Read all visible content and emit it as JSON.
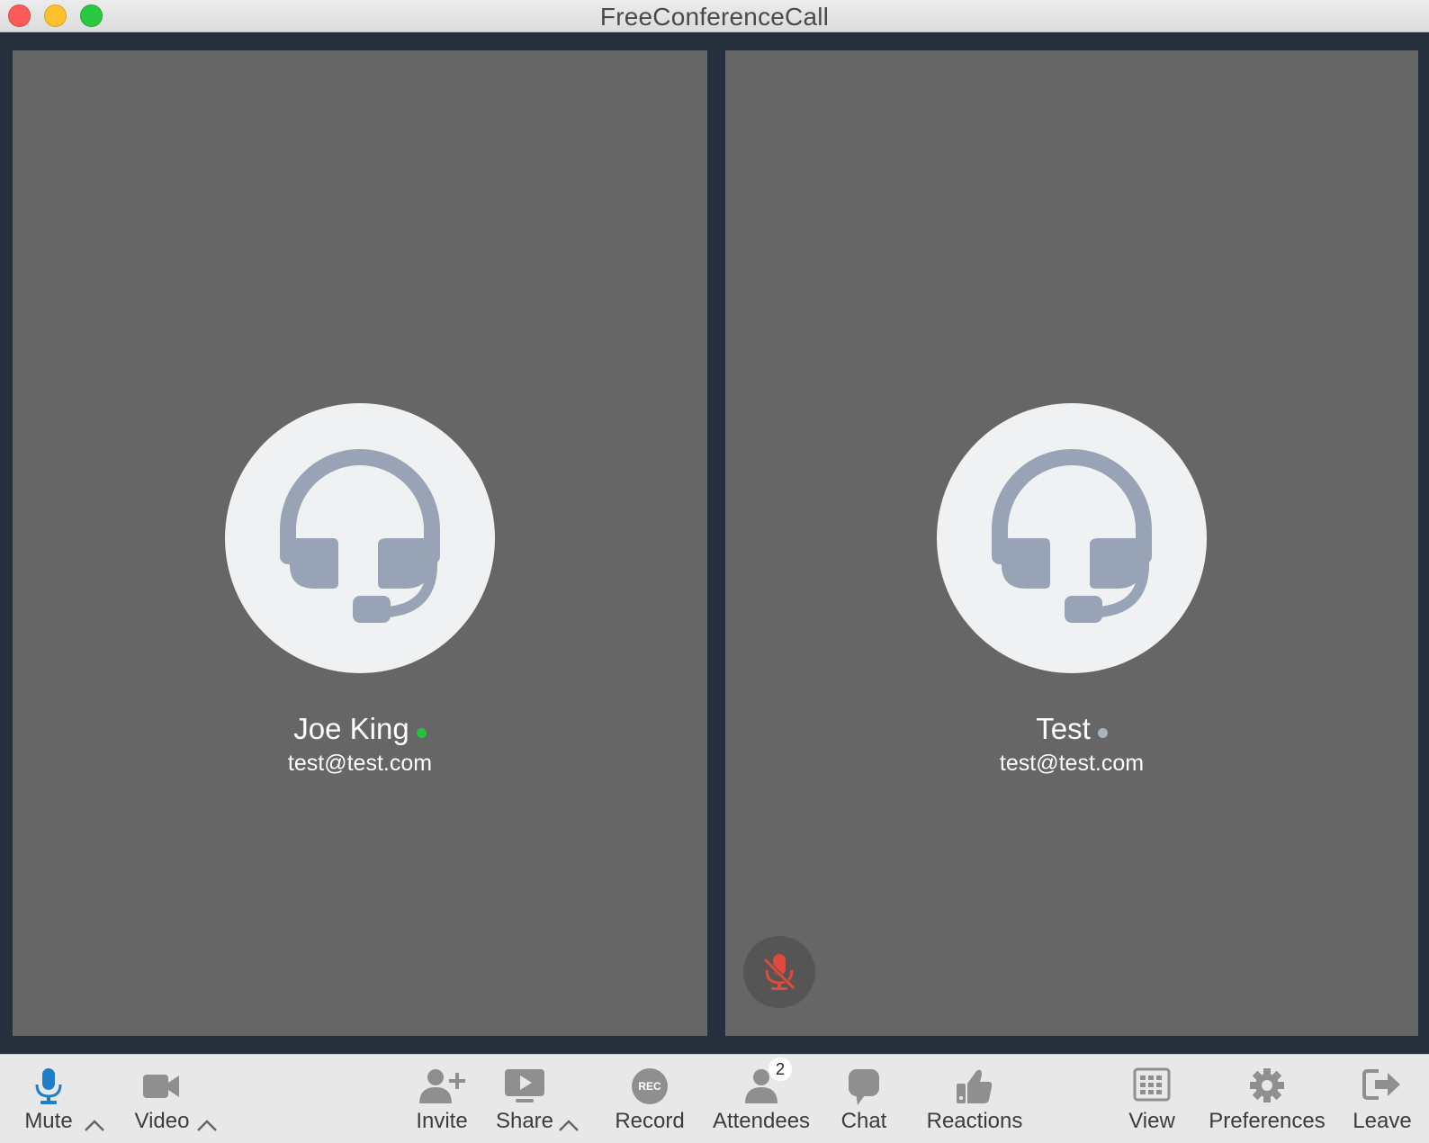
{
  "window": {
    "title": "FreeConferenceCall"
  },
  "participants": [
    {
      "name": "Joe King",
      "email": "test@test.com",
      "status_color": "#22c33a",
      "avatar_icon": "headset-icon"
    },
    {
      "name": "Test",
      "email": "test@test.com",
      "status_color": "#aab3c2",
      "avatar_icon": "headset-icon",
      "muted": true,
      "muted_icon": "mic-muted-icon"
    }
  ],
  "toolbar": {
    "mute": {
      "label": "Mute",
      "icon": "microphone-icon",
      "color": "#1f7fc6"
    },
    "video": {
      "label": "Video",
      "icon": "video-camera-icon"
    },
    "invite": {
      "label": "Invite",
      "icon": "add-person-icon"
    },
    "share": {
      "label": "Share",
      "icon": "screen-share-icon"
    },
    "record": {
      "label": "Record",
      "icon_text": "REC"
    },
    "attendees": {
      "label": "Attendees",
      "count": "2",
      "icon": "person-icon"
    },
    "chat": {
      "label": "Chat",
      "icon": "chat-bubble-icon"
    },
    "reactions": {
      "label": "Reactions",
      "icon": "thumbs-up-icon"
    },
    "view": {
      "label": "View",
      "icon": "grid-view-icon"
    },
    "preferences": {
      "label": "Preferences",
      "icon": "gear-icon"
    },
    "leave": {
      "label": "Leave",
      "icon": "exit-icon"
    }
  },
  "colors": {
    "tile_bg": "#666666",
    "stage_bg": "#26303d",
    "headset": "#98a3b5",
    "icon_gray": "#8f8f8f",
    "muted_red": "#e0493e"
  }
}
